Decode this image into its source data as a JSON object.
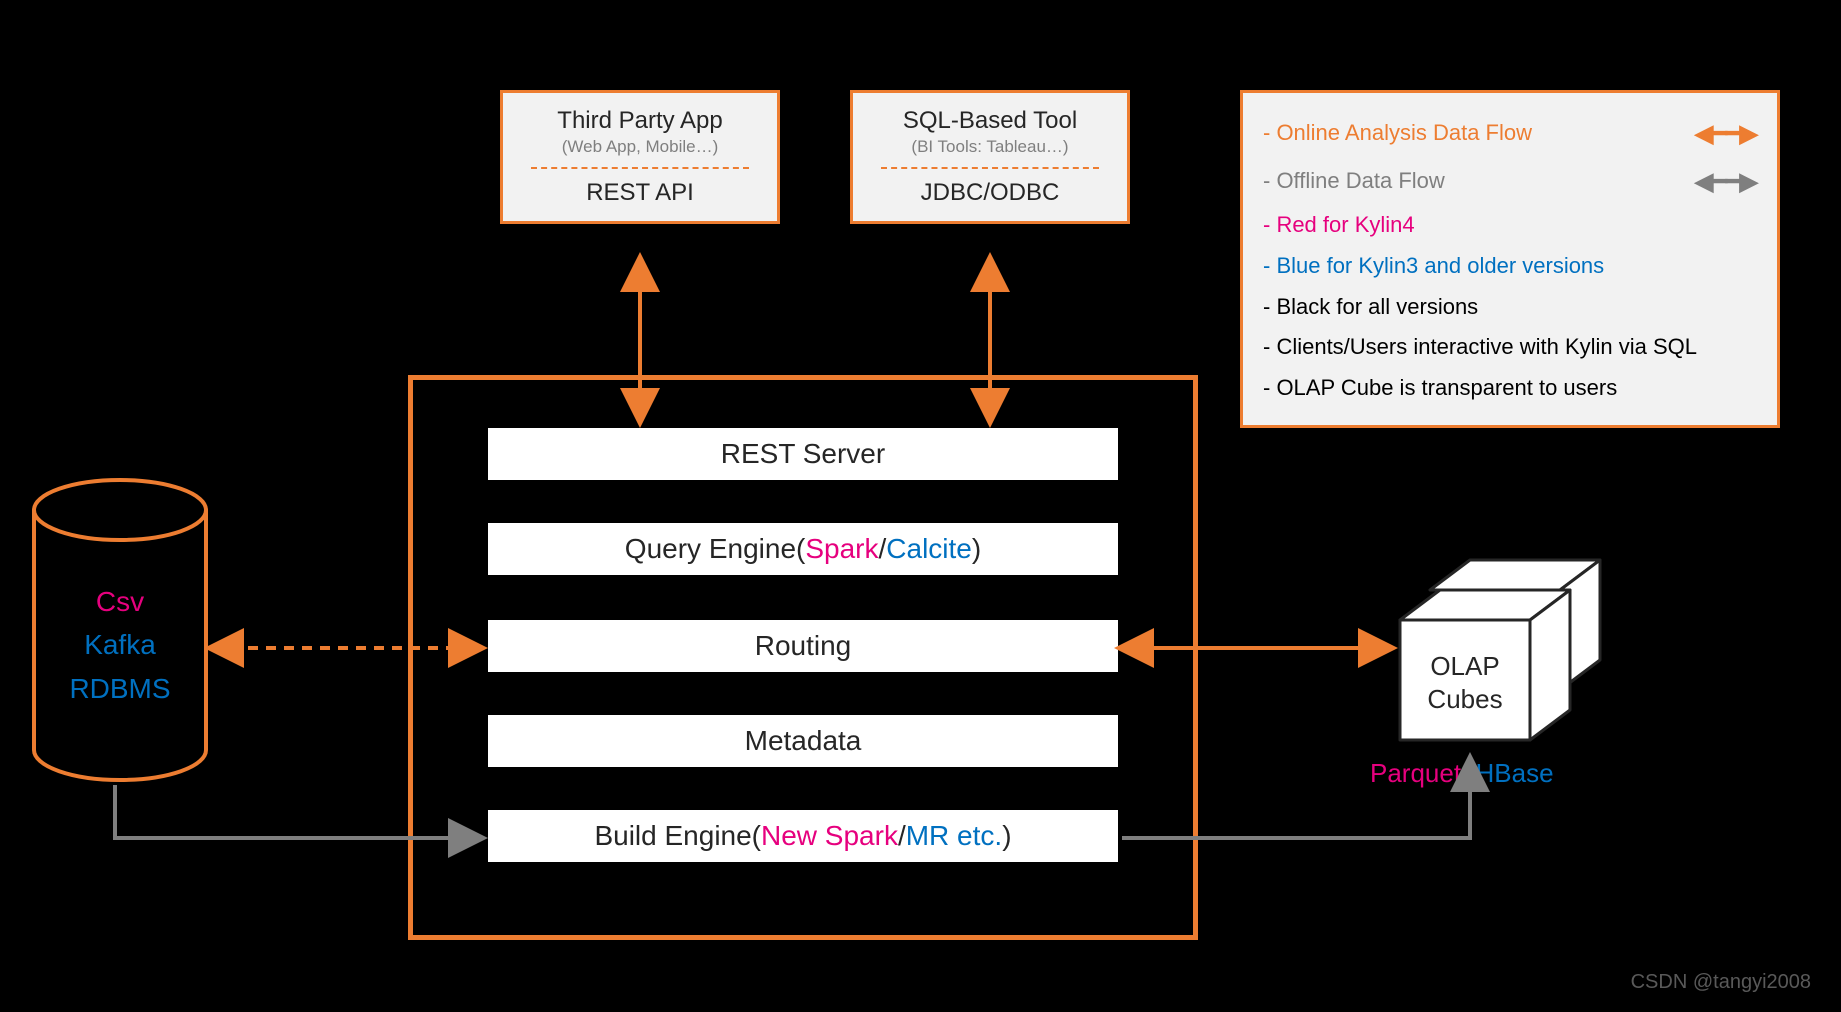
{
  "clients": {
    "left": {
      "title": "Third Party App",
      "subtitle": "(Web App, Mobile…)",
      "protocol": "REST API"
    },
    "right": {
      "title": "SQL-Based Tool",
      "subtitle": "(BI Tools: Tableau…)",
      "protocol": "JDBC/ODBC"
    }
  },
  "layers": {
    "rest_server": "REST Server",
    "query_engine": {
      "prefix": "Query Engine(",
      "red": "Spark",
      "sep": "/",
      "blue": "Calcite",
      "suffix": ")"
    },
    "routing": "Routing",
    "metadata": "Metadata",
    "build_engine": {
      "prefix": "Build Engine(",
      "red": "New Spark",
      "sep": "/",
      "blue": "MR etc.",
      "suffix": ")"
    }
  },
  "datasource": {
    "csv": "Csv",
    "kafka": "Kafka",
    "rdbms": "RDBMS"
  },
  "cubes": {
    "line1": "OLAP",
    "line2": "Cubes",
    "parquet": "Parquet",
    "hbase": "HBase"
  },
  "legend": {
    "online": "- Online Analysis Data Flow",
    "offline": "- Offline Data Flow",
    "red": "- Red for Kylin4",
    "blue": "- Blue for Kylin3 and older versions",
    "black": "- Black for all versions",
    "interactive": "- Clients/Users interactive with Kylin via SQL",
    "transparent": "- OLAP Cube is transparent to users"
  },
  "watermark": "CSDN @tangyi2008"
}
